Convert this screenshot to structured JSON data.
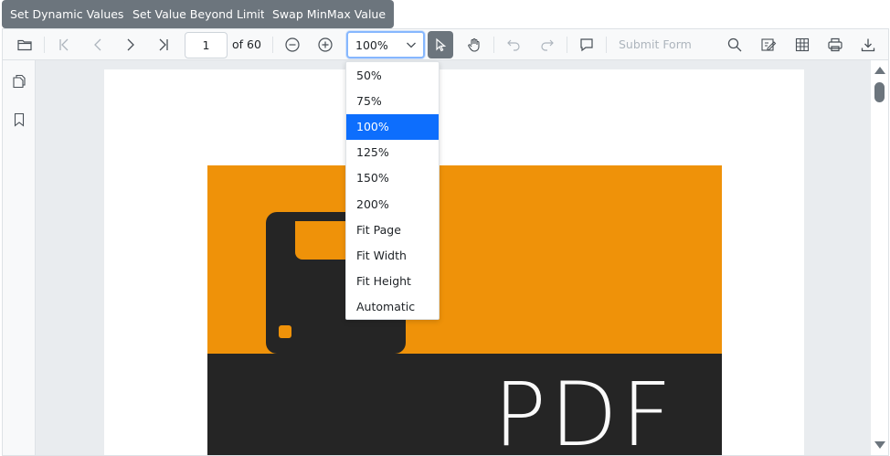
{
  "top_buttons": {
    "set_dynamic": "Set Dynamic Values",
    "set_beyond": "Set Value Beyond Limit",
    "swap_minmax": "Swap MinMax Value"
  },
  "toolbar": {
    "current_page": "1",
    "of_pages": "of 60",
    "zoom_value": "100%",
    "submit_form_label": "Submit Form",
    "icons": [
      "folder-open-icon",
      "first-page-icon",
      "previous-page-icon",
      "next-page-icon",
      "last-page-icon",
      "zoom-out-icon",
      "zoom-in-icon",
      "chevron-down-icon",
      "text-select-icon",
      "pan-hand-icon",
      "undo-icon",
      "redo-icon",
      "comment-icon",
      "search-icon",
      "annotation-icon",
      "form-designer-icon",
      "print-icon",
      "download-icon"
    ]
  },
  "nav_pane": {
    "icons": [
      "page-thumbnails-icon",
      "bookmark-icon"
    ]
  },
  "zoom_dropdown": {
    "selected": "100%",
    "options": [
      "50%",
      "75%",
      "100%",
      "125%",
      "150%",
      "200%",
      "Fit Page",
      "Fit Width",
      "Fit Height",
      "Automatic"
    ]
  },
  "document": {
    "cover_text": "PDF"
  },
  "colors": {
    "button_gray": "#6c757d",
    "accent_blue": "#0d6efd",
    "cover_orange": "#ef9209",
    "cover_dark": "#252525"
  }
}
